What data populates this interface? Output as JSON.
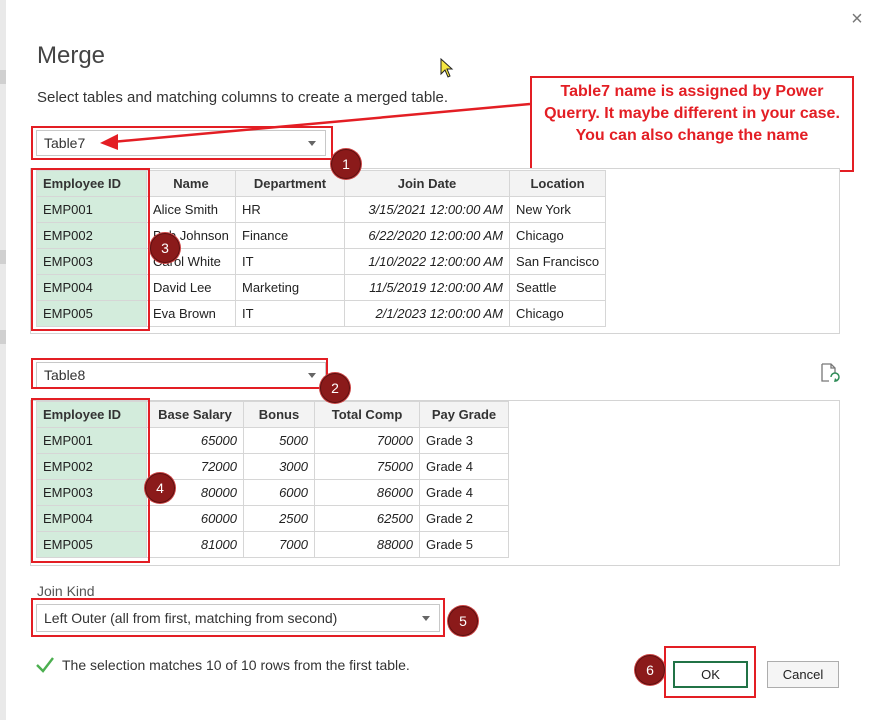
{
  "dialog": {
    "title": "Merge",
    "subtitle": "Select tables and matching columns to create a merged table.",
    "close_glyph": "×"
  },
  "first_table": {
    "selected": "Table7",
    "columns": [
      "Employee ID",
      "Name",
      "Department",
      "Join Date",
      "Location"
    ],
    "rows": [
      [
        "EMP001",
        "Alice Smith",
        "HR",
        "3/15/2021 12:00:00 AM",
        "New York"
      ],
      [
        "EMP002",
        "Bob Johnson",
        "Finance",
        "6/22/2020 12:00:00 AM",
        "Chicago"
      ],
      [
        "EMP003",
        "Carol White",
        "IT",
        "1/10/2022 12:00:00 AM",
        "San Francisco"
      ],
      [
        "EMP004",
        "David Lee",
        "Marketing",
        "11/5/2019 12:00:00 AM",
        "Seattle"
      ],
      [
        "EMP005",
        "Eva Brown",
        "IT",
        "2/1/2023 12:00:00 AM",
        "Chicago"
      ]
    ]
  },
  "second_table": {
    "selected": "Table8",
    "columns": [
      "Employee ID",
      "Base Salary",
      "Bonus",
      "Total Comp",
      "Pay Grade"
    ],
    "rows": [
      [
        "EMP001",
        "65000",
        "5000",
        "70000",
        "Grade 3"
      ],
      [
        "EMP002",
        "72000",
        "3000",
        "75000",
        "Grade 4"
      ],
      [
        "EMP003",
        "80000",
        "6000",
        "86000",
        "Grade 4"
      ],
      [
        "EMP004",
        "60000",
        "2500",
        "62500",
        "Grade 2"
      ],
      [
        "EMP005",
        "81000",
        "7000",
        "88000",
        "Grade 5"
      ]
    ]
  },
  "join": {
    "label": "Join Kind",
    "selected": "Left Outer (all from first, matching from second)"
  },
  "status": "The selection matches 10 of 10 rows from the first table.",
  "buttons": {
    "ok": "OK",
    "cancel": "Cancel"
  },
  "annotations": {
    "callout": "Table7 name is assigned by Power Querry. It maybe different in your case. You can also change the name",
    "badges": [
      "1",
      "2",
      "3",
      "4",
      "5",
      "6"
    ]
  },
  "colors": {
    "annotation_red": "#e31e24",
    "badge_fill": "#8b1a1a",
    "key_column": "#d3ecdc",
    "ok_border": "#217346",
    "check_green": "#4caf50"
  }
}
